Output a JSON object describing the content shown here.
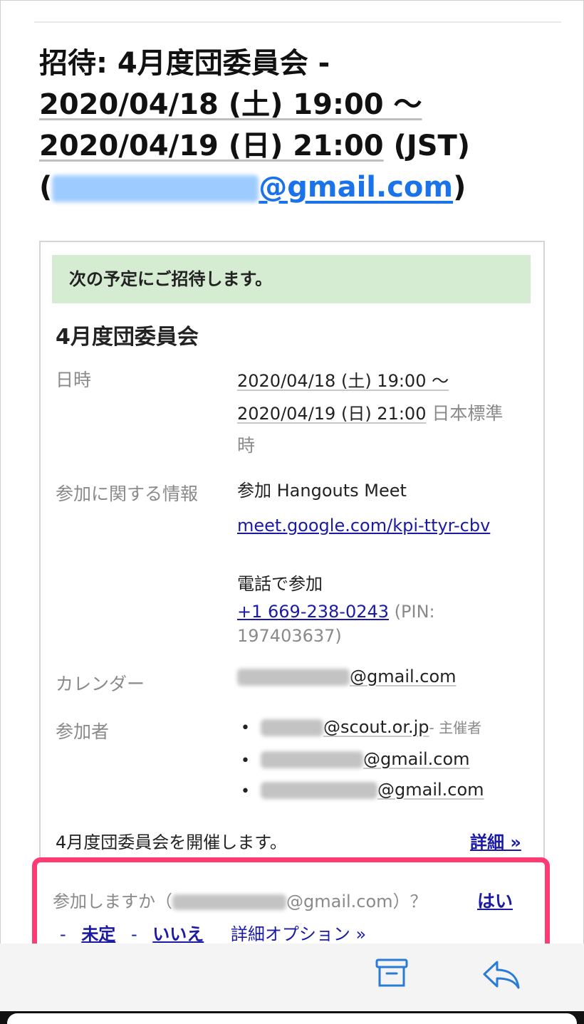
{
  "subject": {
    "prefix": "招待: 4月度団委員会 -",
    "start": "2020/04/18 (土) 19:00 〜",
    "end": "2020/04/19 (日) 21:00",
    "tz": " (JST)",
    "open_paren": "(",
    "email_domain": "@gmail.com",
    "close_paren": ")"
  },
  "invite": {
    "banner": "次の予定にご招待します。",
    "event_title": "4月度団委員会",
    "labels": {
      "datetime": "日時",
      "join_info": "参加に関する情報",
      "calendar": "カレンダー",
      "attendees": "参加者"
    },
    "datetime": {
      "line1": "2020/04/18 (土) 19:00 〜",
      "line2": "2020/04/19 (日) 21:00",
      "tz_a": " 日本標準",
      "tz_b": "時"
    },
    "join": {
      "meet_label": "参加 Hangouts Meet",
      "meet_link": "meet.google.com/kpi-ttyr-cbv",
      "phone_label": "電話で参加",
      "phone_number": "+1 669-238-0243",
      "pin_a": " (PIN:",
      "pin_b": "197403637)"
    },
    "calendar_domain": "@gmail.com",
    "attendees": [
      {
        "domain": "@scout.or.jp",
        "role": "- 主催者"
      },
      {
        "domain": "@gmail.com",
        "role": ""
      },
      {
        "domain": "@gmail.com",
        "role": ""
      }
    ],
    "description": "4月度団委員会を開催します。",
    "details_link": "詳細 »"
  },
  "rsvp": {
    "question_prefix": "参加しますか（",
    "question_domain": "@gmail.com",
    "question_suffix": "）？",
    "yes": "はい",
    "dash": "-",
    "maybe": "未定",
    "no": "いいえ",
    "more_options": "詳細オプション »"
  },
  "colors": {
    "accent": "#ff3b74",
    "banner_bg": "#d6ecd2",
    "link": "#1a1aa6",
    "email_link": "#1a73e8",
    "icon_blue": "#2a7bd6"
  },
  "toolbar": {
    "icons": [
      "archive-icon",
      "reply-icon"
    ]
  }
}
